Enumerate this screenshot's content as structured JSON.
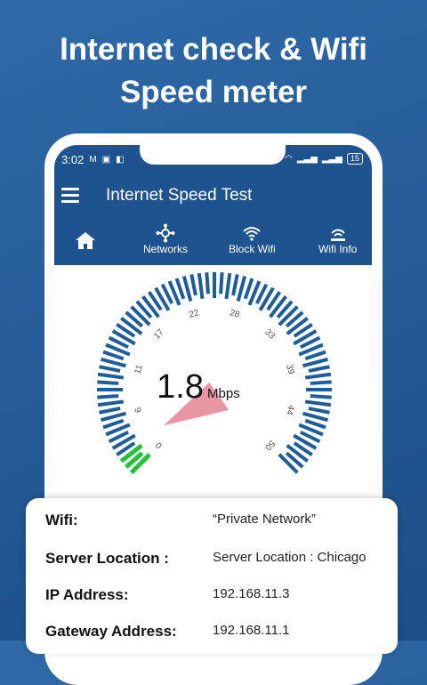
{
  "promo": {
    "headline_line1": "Internet check & Wifi",
    "headline_line2": "Speed meter"
  },
  "status_bar": {
    "time": "3:02",
    "icons_left": [
      "gmail-icon",
      "app-icon",
      "app-icon"
    ],
    "icons_right": [
      "wifi-icon",
      "signal-icon",
      "signal-icon"
    ],
    "battery": "15"
  },
  "app_bar": {
    "title": "Internet Speed Test",
    "nav": [
      {
        "label": "",
        "icon": "home-icon",
        "active": true
      },
      {
        "label": "Networks",
        "icon": "network-icon"
      },
      {
        "label": "Block Wifi",
        "icon": "wifi-icon"
      },
      {
        "label": "Wifi Info",
        "icon": "wifi-info-icon"
      }
    ]
  },
  "gauge": {
    "speed": "1.8",
    "unit": "Mbps",
    "scale_labels": [
      "0",
      "6",
      "11",
      "17",
      "22",
      "28",
      "33",
      "39",
      "44",
      "50"
    ],
    "max": 50,
    "value": 1.8,
    "colors": {
      "ticks": "#1f5d98",
      "active": "#22c33a",
      "needle": "#e58494"
    }
  },
  "info": {
    "rows": [
      {
        "label": "Wifi:",
        "value": "“Private Network”"
      },
      {
        "label": "Server Location :",
        "value": "Server Location :  Chicago"
      },
      {
        "label": "IP Address:",
        "value": "192.168.11.3"
      },
      {
        "label": "Gateway Address:",
        "value": "192.168.11.1"
      }
    ]
  }
}
